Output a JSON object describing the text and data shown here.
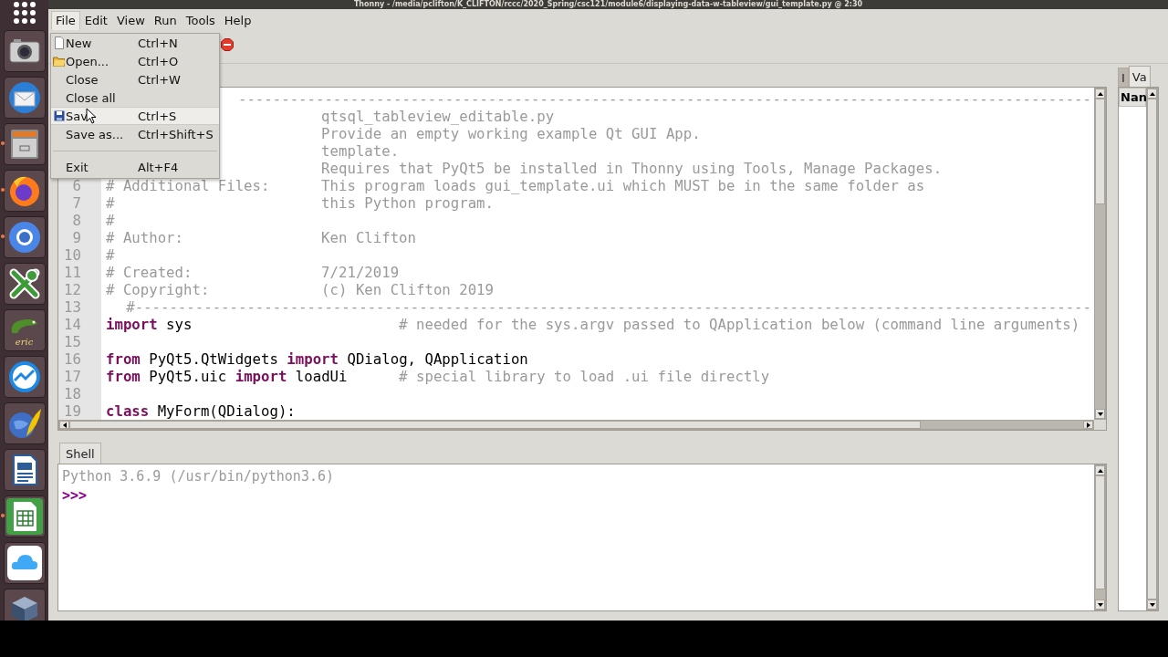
{
  "window": {
    "title": "Thonny - /media/pclifton/K_CLIFTON/rccc/2020_Spring/csc121/module6/displaying-data-w-tableview/gui_template.py @ 2:30"
  },
  "dock": [
    {
      "kind": "apps"
    },
    {
      "kind": "camera",
      "running": false
    },
    {
      "kind": "mail",
      "running": false
    },
    {
      "kind": "files",
      "running": true
    },
    {
      "kind": "firefox",
      "running": true
    },
    {
      "kind": "chromium",
      "running": true
    },
    {
      "kind": "xmind",
      "running": false
    },
    {
      "kind": "eric",
      "running": false,
      "label": "eric"
    },
    {
      "kind": "chart",
      "running": false
    },
    {
      "kind": "globe",
      "running": false
    },
    {
      "kind": "writer",
      "running": false
    },
    {
      "kind": "calc",
      "running": true
    },
    {
      "kind": "cloud",
      "running": false
    },
    {
      "kind": "cube",
      "running": false
    }
  ],
  "menubar": [
    {
      "label": "File",
      "selected": true
    },
    {
      "label": "Edit",
      "selected": false
    },
    {
      "label": "View",
      "selected": false
    },
    {
      "label": "Run",
      "selected": false
    },
    {
      "label": "Tools",
      "selected": false
    },
    {
      "label": "Help",
      "selected": false
    }
  ],
  "toolbar": [
    {
      "kind": "stop"
    }
  ],
  "file_menu": [
    {
      "kind": "new",
      "label": "New",
      "shortcut": "Ctrl+N",
      "selected": false
    },
    {
      "kind": "open",
      "label": "Open...",
      "shortcut": "Ctrl+O",
      "selected": false
    },
    {
      "kind": "plain",
      "label": "Close",
      "shortcut": "Ctrl+W",
      "selected": false
    },
    {
      "kind": "plain",
      "label": "Close all",
      "selected": false
    },
    {
      "kind": "save",
      "label": "Sav",
      "shortcut": "Ctrl+S",
      "selected": true
    },
    {
      "kind": "plain",
      "label": "Save as...",
      "shortcut": "Ctrl+Shift+S",
      "selected": false
    },
    {
      "kind": "separator"
    },
    {
      "kind": "plain",
      "label": "Exit",
      "shortcut": "Alt+F4",
      "selected": false
    }
  ],
  "editor": {
    "lines": [
      {
        "rule": "---------------------------------------------------------------------------------------------------"
      },
      {
        "value": "qtsql_tableview_editable.py"
      },
      {
        "value": "Provide an empty working example Qt GUI App."
      },
      {
        "value": "template."
      },
      {
        "value": "Requires that PyQt5 be installed in Thonny using Tools, Manage Packages."
      },
      {
        "number": "6",
        "label": "# Additional Files:",
        "value": "This program loads gui_template.ui which MUST be in the same folder as"
      },
      {
        "number": "7",
        "label": "#",
        "value": "this Python program."
      },
      {
        "number": "8",
        "label": "#"
      },
      {
        "number": "9",
        "label": "# Author:",
        "value": "Ken Clifton"
      },
      {
        "number": "10",
        "label": "#"
      },
      {
        "number": "11",
        "label": "# Created:",
        "value": "7/21/2019"
      },
      {
        "number": "12",
        "label": "# Copyright:",
        "value": "(c) Ken Clifton 2019"
      },
      {
        "number": "13",
        "rule": "#---------------------------------------------------------------------------------------------------------------"
      },
      {
        "number": "14",
        "code": [
          {
            "kind": "keyword",
            "text": "import"
          },
          {
            "kind": "plain",
            "text": " sys"
          }
        ],
        "comment": "# needed for the sys.argv passed to QApplication below (command line arguments)"
      },
      {
        "number": "15"
      },
      {
        "number": "16",
        "code": [
          {
            "kind": "keyword",
            "text": "from"
          },
          {
            "kind": "plain",
            "text": " PyQt5.QtWidgets "
          },
          {
            "kind": "keyword",
            "text": "import"
          },
          {
            "kind": "plain",
            "text": " QDialog, QApplication"
          }
        ]
      },
      {
        "number": "17",
        "code": [
          {
            "kind": "keyword",
            "text": "from"
          },
          {
            "kind": "plain",
            "text": " PyQt5.uic "
          },
          {
            "kind": "keyword",
            "text": "import"
          },
          {
            "kind": "plain",
            "text": " loadUi"
          }
        ],
        "comment": "# special library to load .ui file directly"
      },
      {
        "number": "18"
      },
      {
        "number": "19",
        "code": [
          {
            "kind": "keyword",
            "text": "class"
          },
          {
            "kind": "plain",
            "text": " MyForm(QDialog):"
          }
        ]
      }
    ]
  },
  "shell": {
    "tab": "Shell",
    "banner": "Python 3.6.9 (/usr/bin/python3.6)",
    "prompt": ">>>"
  },
  "side_panel": {
    "tabs": [
      {
        "label": "I",
        "selected": false
      },
      {
        "label": "Va",
        "selected": true
      }
    ],
    "columns": [
      "Nan"
    ]
  }
}
